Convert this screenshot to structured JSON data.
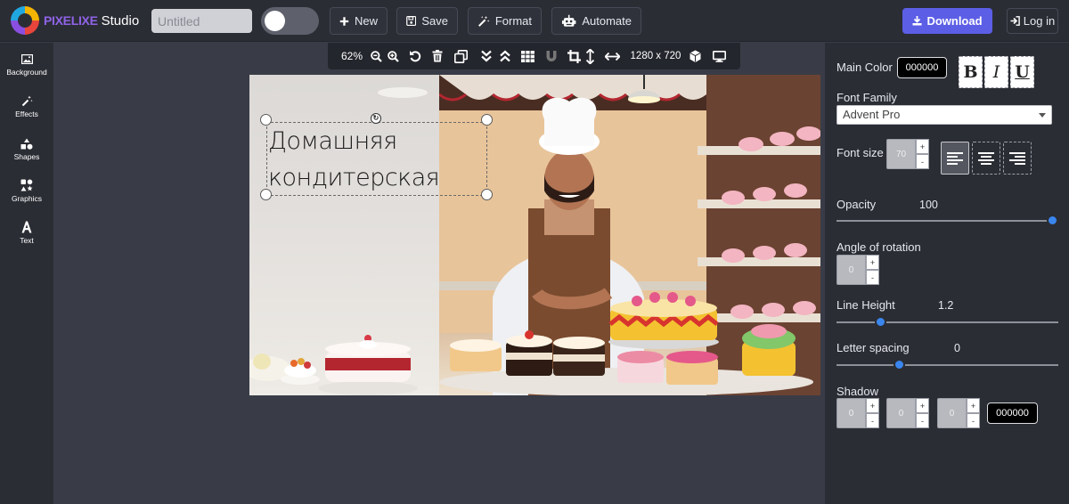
{
  "brand": {
    "logo_text": "PIXELIXE",
    "studio": "Studio"
  },
  "topbar": {
    "title_placeholder": "Untitled",
    "new_label": "New",
    "save_label": "Save",
    "format_label": "Format",
    "automate_label": "Automate",
    "download_label": "Download",
    "login_label": "Log in"
  },
  "sidebar": {
    "items": [
      {
        "label": "Background",
        "icon": "image-icon"
      },
      {
        "label": "Effects",
        "icon": "magic-wand-icon"
      },
      {
        "label": "Shapes",
        "icon": "shapes-icon"
      },
      {
        "label": "Graphics",
        "icon": "graphics-icon"
      },
      {
        "label": "Text",
        "icon": "text-icon"
      }
    ]
  },
  "canvas_toolbar": {
    "zoom": "62%",
    "dimensions": "1280 x 720"
  },
  "canvas": {
    "text_lines": [
      "Домашняя",
      "кондитерская"
    ]
  },
  "panel": {
    "main_color_label": "Main Color",
    "main_color_value": "000000",
    "bold": "B",
    "italic": "I",
    "underline": "U",
    "font_family_label": "Font Family",
    "font_family_value": "Advent Pro",
    "font_size_label": "Font size",
    "font_size_value": "70",
    "opacity_label": "Opacity",
    "opacity_value": "100",
    "opacity_fraction": 1.0,
    "rotation_label": "Angle of rotation",
    "rotation_value": "0",
    "line_height_label": "Line Height",
    "line_height_value": "1.2",
    "letter_spacing_label": "Letter spacing",
    "letter_spacing_value": "0",
    "shadow_label": "Shadow",
    "shadow_x": "0",
    "shadow_y": "0",
    "shadow_blur": "0",
    "shadow_color": "000000",
    "plus": "+",
    "minus": "-"
  },
  "colors": {
    "accent": "#5c5ee6",
    "slider": "#3a86ef",
    "panel_bg": "#2b2d35",
    "workspace": "#393c47"
  }
}
